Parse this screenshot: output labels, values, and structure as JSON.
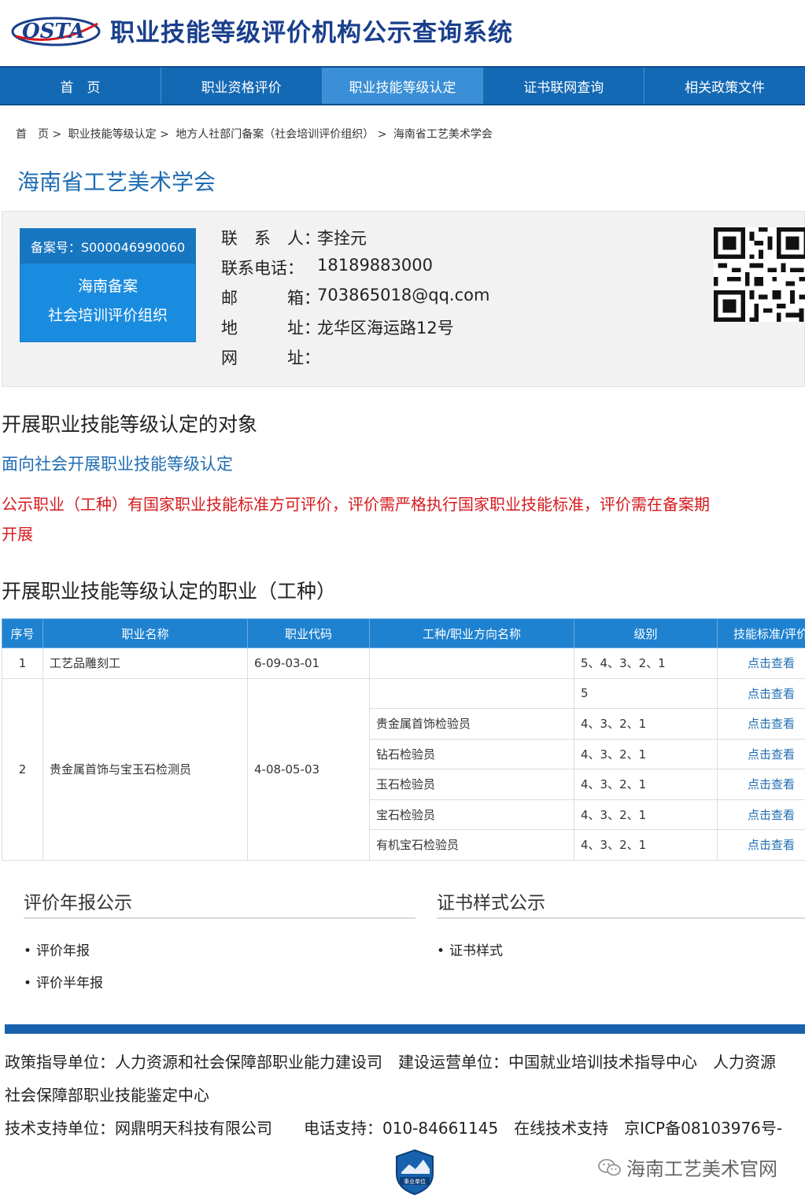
{
  "header": {
    "logo_text": "OSTA",
    "title": "职业技能等级评价机构公示查询系统"
  },
  "nav": {
    "items": [
      {
        "label": "首　页"
      },
      {
        "label": "职业资格评价"
      },
      {
        "label": "职业技能等级认定"
      },
      {
        "label": "证书联网查询"
      },
      {
        "label": "相关政策文件"
      }
    ],
    "active_index": 2
  },
  "breadcrumb": {
    "items": [
      "首　页",
      "职业技能等级认定",
      "地方人社部门备案（社会培训评价组织）",
      "海南省工艺美术学会"
    ],
    "separator": ">"
  },
  "org": {
    "name": "海南省工艺美术学会",
    "badge_record": "备案号：S000046990060",
    "badge_line1": "海南备案",
    "badge_line2": "社会培训评价组织",
    "contact_rows": [
      {
        "label": "联　系　人：",
        "value": "李拴元"
      },
      {
        "label": "联系电话：",
        "value": "18189883000"
      },
      {
        "label": "邮　　　箱：",
        "value": "703865018@qq.com"
      },
      {
        "label": "地　　　址：",
        "value": "龙华区海运路12号"
      },
      {
        "label": "网　　　址：",
        "value": ""
      }
    ]
  },
  "targets": {
    "heading": "开展职业技能等级认定的对象",
    "subheading": "面向社会开展职业技能等级认定",
    "notice_line1": "公示职业（工种）有国家职业技能标准方可评价，评价需严格执行国家职业技能标准，评价需在备案期",
    "notice_line2": "开展"
  },
  "occupations": {
    "heading": "开展职业技能等级认定的职业（工种）",
    "columns": [
      "序号",
      "职业名称",
      "职业代码",
      "工种/职业方向名称",
      "级别",
      "技能标准/评价规"
    ],
    "row1": {
      "no": "1",
      "name": "工艺品雕刻工",
      "code": "6-09-03-01",
      "subtype": "",
      "level": "5、4、3、2、1",
      "link": "点击查看"
    },
    "row2": {
      "no": "2",
      "name": "贵金属首饰与宝玉石检测员",
      "code": "4-08-05-03",
      "subrows": [
        {
          "subtype": "",
          "level": "5",
          "link": "点击查看"
        },
        {
          "subtype": "贵金属首饰检验员",
          "level": "4、3、2、1",
          "link": "点击查看"
        },
        {
          "subtype": "钻石检验员",
          "level": "4、3、2、1",
          "link": "点击查看"
        },
        {
          "subtype": "玉石检验员",
          "level": "4、3、2、1",
          "link": "点击查看"
        },
        {
          "subtype": "宝石检验员",
          "level": "4、3、2、1",
          "link": "点击查看"
        },
        {
          "subtype": "有机宝石检验员",
          "level": "4、3、2、1",
          "link": "点击查看"
        }
      ]
    }
  },
  "reports": {
    "annual_title": "评价年报公示",
    "annual_items": [
      "评价年报",
      "评价半年报"
    ],
    "cert_title": "证书样式公示",
    "cert_items": [
      "证书样式"
    ]
  },
  "footer": {
    "line1": "政策指导单位：人力资源和社会保障部职业能力建设司　建设运营单位：中国就业培训技术指导中心　人力资源",
    "line2": "社会保障部职业技能鉴定中心",
    "line3": "技术支持单位：网鼎明天科技有限公司　　电话支持：010-84661145　在线技术支持　京ICP备08103976号-",
    "emblem_text": "事业单位",
    "watermark": "海南工艺美术官网"
  },
  "colors": {
    "nav": "#1469b5",
    "nav_active": "#3b8fd6",
    "title_blue": "#1a3f8c",
    "link_blue": "#1f6db3",
    "notice_red": "#d6191e",
    "table_header": "#1f82d0"
  }
}
